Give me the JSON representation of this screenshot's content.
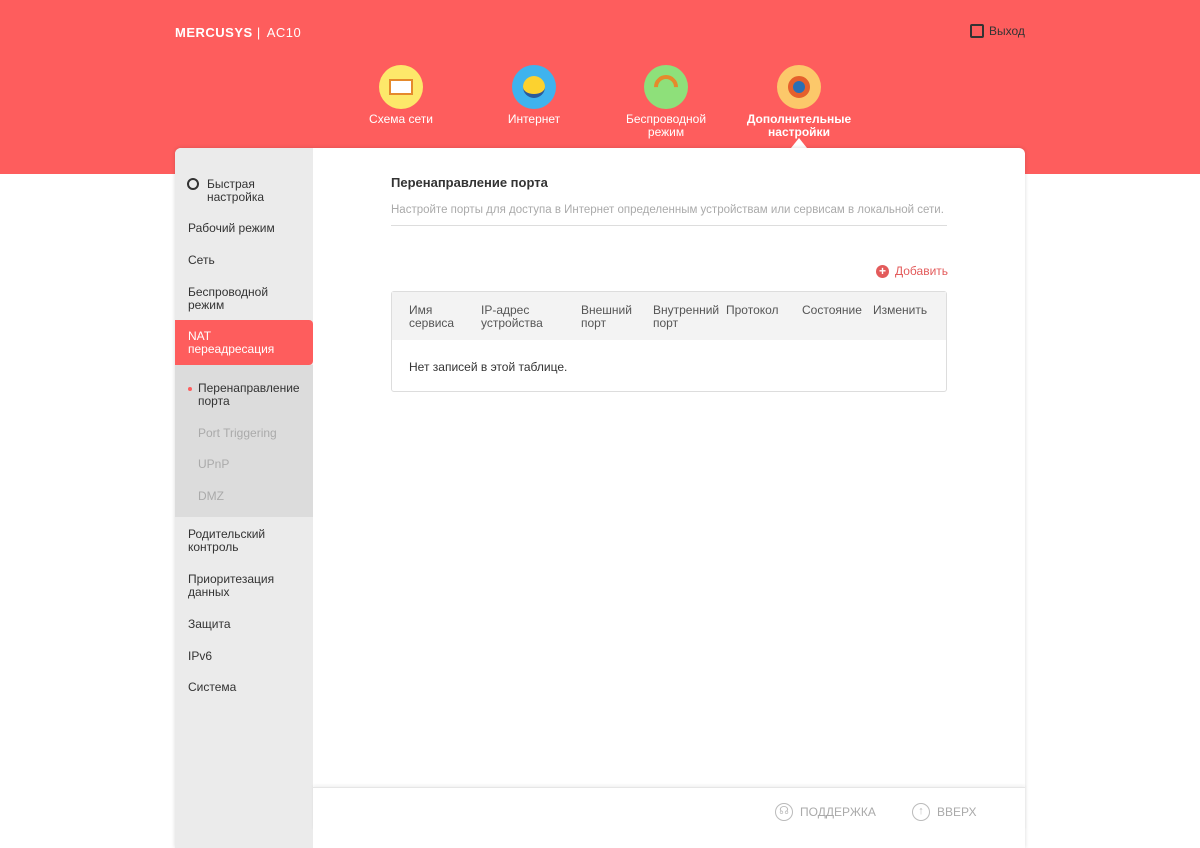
{
  "header": {
    "brand": "MERCUSYS",
    "model": "AC10",
    "logout": "Выход"
  },
  "nav": [
    {
      "label": "Схема сети"
    },
    {
      "label": "Интернет"
    },
    {
      "label": "Беспроводной режим"
    },
    {
      "label": "Дополнительные настройки"
    }
  ],
  "sidebar": {
    "items": [
      "Быстрая настройка",
      "Рабочий режим",
      "Сеть",
      "Беспроводной режим",
      "NAT переадресация",
      "Родительский контроль",
      "Приоритезация данных",
      "Защита",
      "IPv6",
      "Система"
    ],
    "sub": [
      "Перенаправление порта",
      "Port Triggering",
      "UPnP",
      "DMZ"
    ]
  },
  "main": {
    "title": "Перенаправление порта",
    "description": "Настройте порты для доступа в Интернет определенным устройствам или сервисам в локальной сети.",
    "add": "Добавить",
    "columns": [
      "Имя сервиса",
      "IP-адрес устройства",
      "Внешний порт",
      "Внутренний порт",
      "Протокол",
      "Состояние",
      "Изменить"
    ],
    "empty": "Нет записей в этой таблице."
  },
  "footer": {
    "support": "ПОДДЕРЖКА",
    "top": "ВВЕРХ"
  }
}
